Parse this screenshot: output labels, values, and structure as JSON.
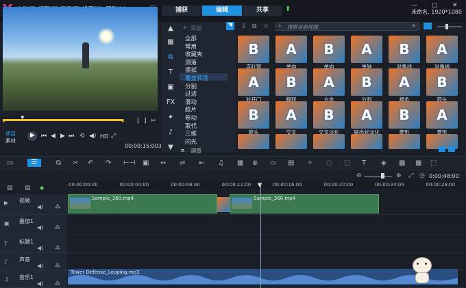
{
  "menu": [
    "文件(F)",
    "编辑(E)",
    "工具(T)",
    "设置(S)",
    "帮助(H)"
  ],
  "tabs": [
    "捕获",
    "编辑",
    "共享"
  ],
  "project_title": "未命名, 1920*1080",
  "preview": {
    "project_label": "项目",
    "clip_label": "素材",
    "hd_label": "HD",
    "timecode": "00:00:15:003"
  },
  "categories": {
    "add_label": "添加",
    "items": [
      "全部",
      "常用",
      "收藏夹",
      "测落",
      "擦拭",
      "覆盖转场",
      "分割",
      "过滤",
      "滑动",
      "胶片",
      "卷动",
      "取代",
      "三维",
      "闪光"
    ],
    "selected": "覆盖转场",
    "browse_label": "浏览"
  },
  "search": {
    "placeholder": "搜索当前视图"
  },
  "gallery": {
    "row1": [
      "百叶窗",
      "单向",
      "单向",
      "单轴",
      "对角线",
      "对角线"
    ],
    "row2": [
      "对开门",
      "翻转",
      "方盒",
      "分割",
      "横条",
      "箭头"
    ],
    "row3": [
      "箭头",
      "交叉",
      "交叉淡化",
      "锯齿状淡化",
      "菱形",
      "菱形"
    ]
  },
  "ruler": [
    "00:00:00:00",
    "00:00:04:00",
    "00:00:08:00",
    "00:00:12:00",
    "00:00:16:00",
    "00:00:20:00",
    "00:00:24:00",
    "00:00:28:00"
  ],
  "zoom_timecode": "0:00:48:00",
  "tracks": [
    {
      "name": "视频"
    },
    {
      "name": "叠加1"
    },
    {
      "name": "标题1"
    },
    {
      "name": "声音"
    },
    {
      "name": "音乐1"
    }
  ],
  "clips": {
    "video1": "Sample_360.mp4",
    "video2": "Sample_360.mp4",
    "music": "Tower Defense_Looping.mp3"
  },
  "colors": {
    "accent": "#1e90e0",
    "clip_green": "#3b7a50",
    "audio_blue": "#3f79c6"
  }
}
